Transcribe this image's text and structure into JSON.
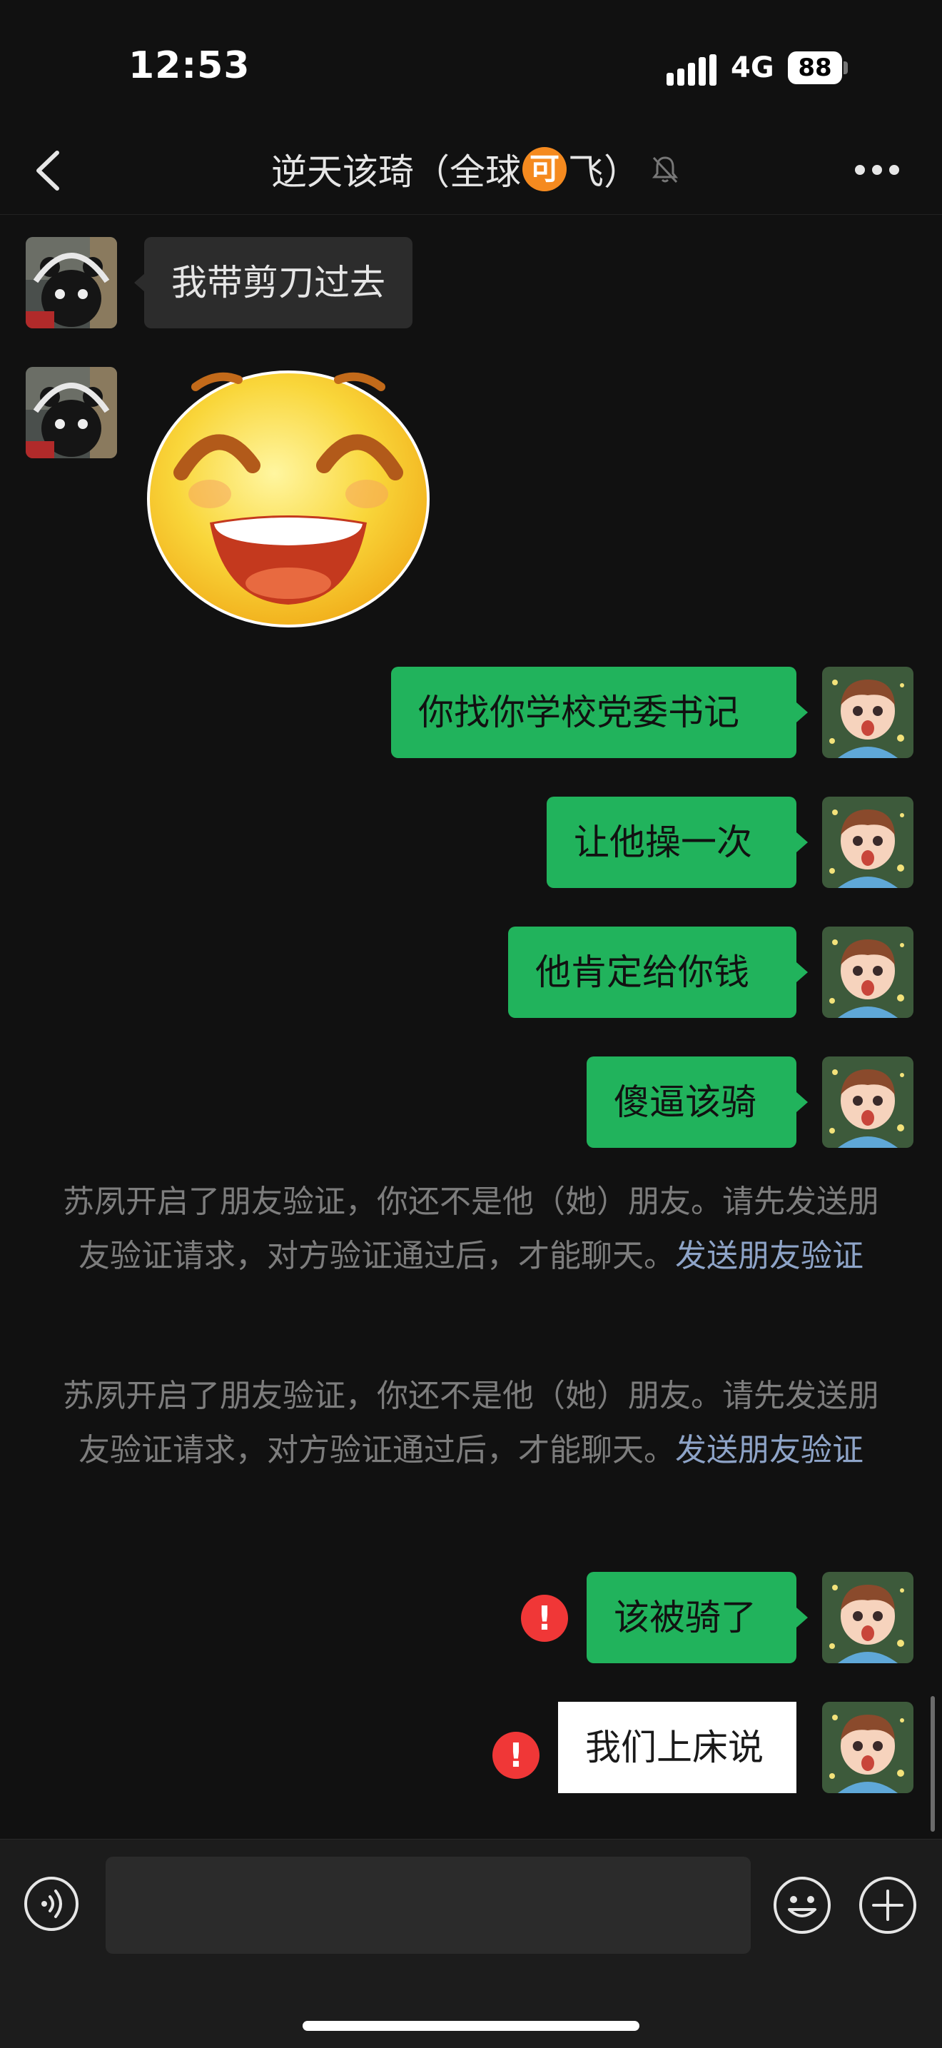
{
  "status_bar": {
    "time": "12:53",
    "network": "4G",
    "battery": "88"
  },
  "header": {
    "title_prefix": "逆天该琦（全球",
    "title_badge": "可",
    "title_suffix": "飞）"
  },
  "messages": [
    {
      "side": "in",
      "type": "text",
      "text": "我带剪刀过去"
    },
    {
      "side": "in",
      "type": "sticker",
      "sticker": "grinning-face"
    },
    {
      "side": "out",
      "type": "text",
      "text": "你找你学校党委书记"
    },
    {
      "side": "out",
      "type": "text",
      "text": "让他操一次"
    },
    {
      "side": "out",
      "type": "text",
      "text": "他肯定给你钱"
    },
    {
      "side": "out",
      "type": "text",
      "text": "傻逼该骑"
    }
  ],
  "system_notices": [
    {
      "text": "苏夙开启了朋友验证，你还不是他（她）朋友。请先发送朋友验证请求，对方验证通过后，才能聊天。",
      "link": "发送朋友验证"
    },
    {
      "text": "苏夙开启了朋友验证，你还不是他（她）朋友。请先发送朋友验证请求，对方验证通过后，才能聊天。",
      "link": "发送朋友验证"
    }
  ],
  "failed_messages": [
    {
      "side": "out",
      "text": "该被骑了",
      "status": "!"
    },
    {
      "side": "out",
      "text": "我们上床说",
      "status": "!"
    }
  ],
  "input": {
    "value": "",
    "placeholder": ""
  },
  "colors": {
    "outgoing_bubble": "#21b35c",
    "incoming_bubble": "#2c2c2c",
    "failed_icon": "#f03737",
    "link": "#8ea4c8",
    "badge": "#f58a1f"
  },
  "icons": [
    "back-arrow-icon",
    "mute-bell-icon",
    "more-icon",
    "voice-icon",
    "emoji-icon",
    "plus-icon"
  ]
}
